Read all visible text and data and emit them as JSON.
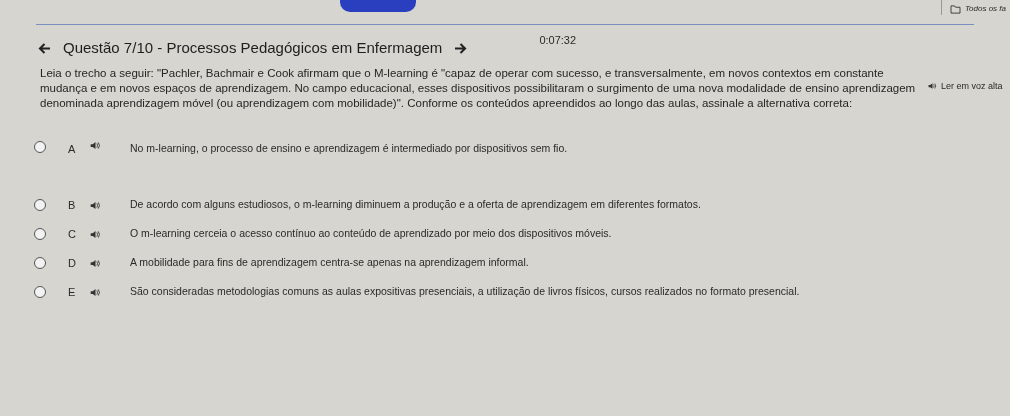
{
  "browser_bar": {
    "bookmark": "Todos os fa"
  },
  "header": {
    "title": "Questão 7/10 - Processos Pedagógicos em Enfermagem",
    "timer": "0:07:32"
  },
  "read_aloud": "Ler em voz alta",
  "question": "Leia o trecho a seguir: \"Pachler, Bachmair e Cook afirmam que o M-learning é \"capaz de operar com sucesso, e transversalmente, em novos contextos em constante mudança e em novos espaços de aprendizagem. No campo educacional, esses dispositivos possibilitaram o surgimento de uma nova modalidade de ensino aprendizagem denominada aprendizagem móvel (ou aprendizagem com mobilidade)\". Conforme os conteúdos apreendidos ao longo das aulas, assinale a alternativa correta:",
  "options": [
    {
      "letter": "A",
      "text": "No m-learning, o processo de ensino e aprendizagem é intermediado por dispositivos sem fio.",
      "selected": false
    },
    {
      "letter": "B",
      "text": "De acordo com alguns estudiosos, o m-learning diminuem a produção e a oferta de aprendizagem em diferentes formatos.",
      "selected": false
    },
    {
      "letter": "C",
      "text": "O m-learning cerceia o acesso contínuo ao conteúdo de aprendizado por meio dos dispositivos móveis.",
      "selected": false
    },
    {
      "letter": "D",
      "text": "A mobilidade para fins de aprendizagem centra-se apenas na aprendizagem informal.",
      "selected": false
    },
    {
      "letter": "E",
      "text": "São consideradas metodologias comuns as aulas expositivas presenciais, a utilização de livros físicos, cursos realizados no formato presencial.",
      "selected": false
    }
  ]
}
